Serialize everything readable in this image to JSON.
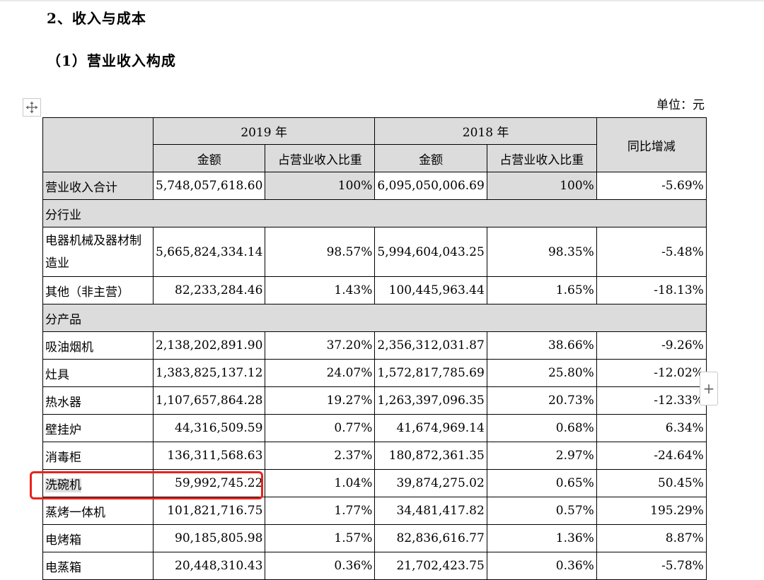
{
  "headings": {
    "section": "2、收入与成本",
    "subsection": "（1）营业收入构成",
    "unit": "单位：元"
  },
  "icons": {
    "move_handle": "move-arrows-icon",
    "add_row": "plus-icon"
  },
  "colors": {
    "header_fill": "#dcdcdc",
    "highlight_box": "#e8231c"
  },
  "table": {
    "year_2019": "2019 年",
    "year_2018": "2018 年",
    "col_amount": "金额",
    "col_ratio": "占营业收入比重",
    "col_yoy": "同比增减",
    "total": {
      "label": "营业收入合计",
      "amount_2019": "5,748,057,618.60",
      "ratio_2019": "100%",
      "amount_2018": "6,095,050,006.69",
      "ratio_2018": "100%",
      "yoy": "-5.69%"
    },
    "section_industry": "分行业",
    "industry": [
      {
        "label": "电器机械及器材制造业",
        "amount_2019": "5,665,824,334.14",
        "ratio_2019": "98.57%",
        "amount_2018": "5,994,604,043.25",
        "ratio_2018": "98.35%",
        "yoy": "-5.48%"
      },
      {
        "label": "其他（非主营）",
        "amount_2019": "82,233,284.46",
        "ratio_2019": "1.43%",
        "amount_2018": "100,445,963.44",
        "ratio_2018": "1.65%",
        "yoy": "-18.13%"
      }
    ],
    "section_product": "分产品",
    "products": [
      {
        "label": "吸油烟机",
        "amount_2019": "2,138,202,891.90",
        "ratio_2019": "37.20%",
        "amount_2018": "2,356,312,031.87",
        "ratio_2018": "38.66%",
        "yoy": "-9.26%"
      },
      {
        "label": "灶具",
        "amount_2019": "1,383,825,137.12",
        "ratio_2019": "24.07%",
        "amount_2018": "1,572,817,785.69",
        "ratio_2018": "25.80%",
        "yoy": "-12.02%"
      },
      {
        "label": "热水器",
        "amount_2019": "1,107,657,864.28",
        "ratio_2019": "19.27%",
        "amount_2018": "1,263,397,096.35",
        "ratio_2018": "20.73%",
        "yoy": "-12.33%"
      },
      {
        "label": "壁挂炉",
        "amount_2019": "44,316,509.59",
        "ratio_2019": "0.77%",
        "amount_2018": "41,674,969.14",
        "ratio_2018": "0.68%",
        "yoy": "6.34%"
      },
      {
        "label": "消毒柜",
        "amount_2019": "136,311,568.63",
        "ratio_2019": "2.37%",
        "amount_2018": "180,872,361.35",
        "ratio_2018": "2.97%",
        "yoy": "-24.64%"
      },
      {
        "label": "洗碗机",
        "amount_2019": "59,992,745.22",
        "ratio_2019": "1.04%",
        "amount_2018": "39,874,275.02",
        "ratio_2018": "0.65%",
        "yoy": "50.45%"
      },
      {
        "label": "蒸烤一体机",
        "amount_2019": "101,821,716.75",
        "ratio_2019": "1.77%",
        "amount_2018": "34,481,417.82",
        "ratio_2018": "0.57%",
        "yoy": "195.29%"
      },
      {
        "label": "电烤箱",
        "amount_2019": "90,185,805.98",
        "ratio_2019": "1.57%",
        "amount_2018": "82,836,616.77",
        "ratio_2018": "1.36%",
        "yoy": "8.87%"
      },
      {
        "label": "电蒸箱",
        "amount_2019": "20,448,310.43",
        "ratio_2019": "0.36%",
        "amount_2018": "21,702,423.75",
        "ratio_2018": "0.36%",
        "yoy": "-5.78%"
      }
    ]
  }
}
